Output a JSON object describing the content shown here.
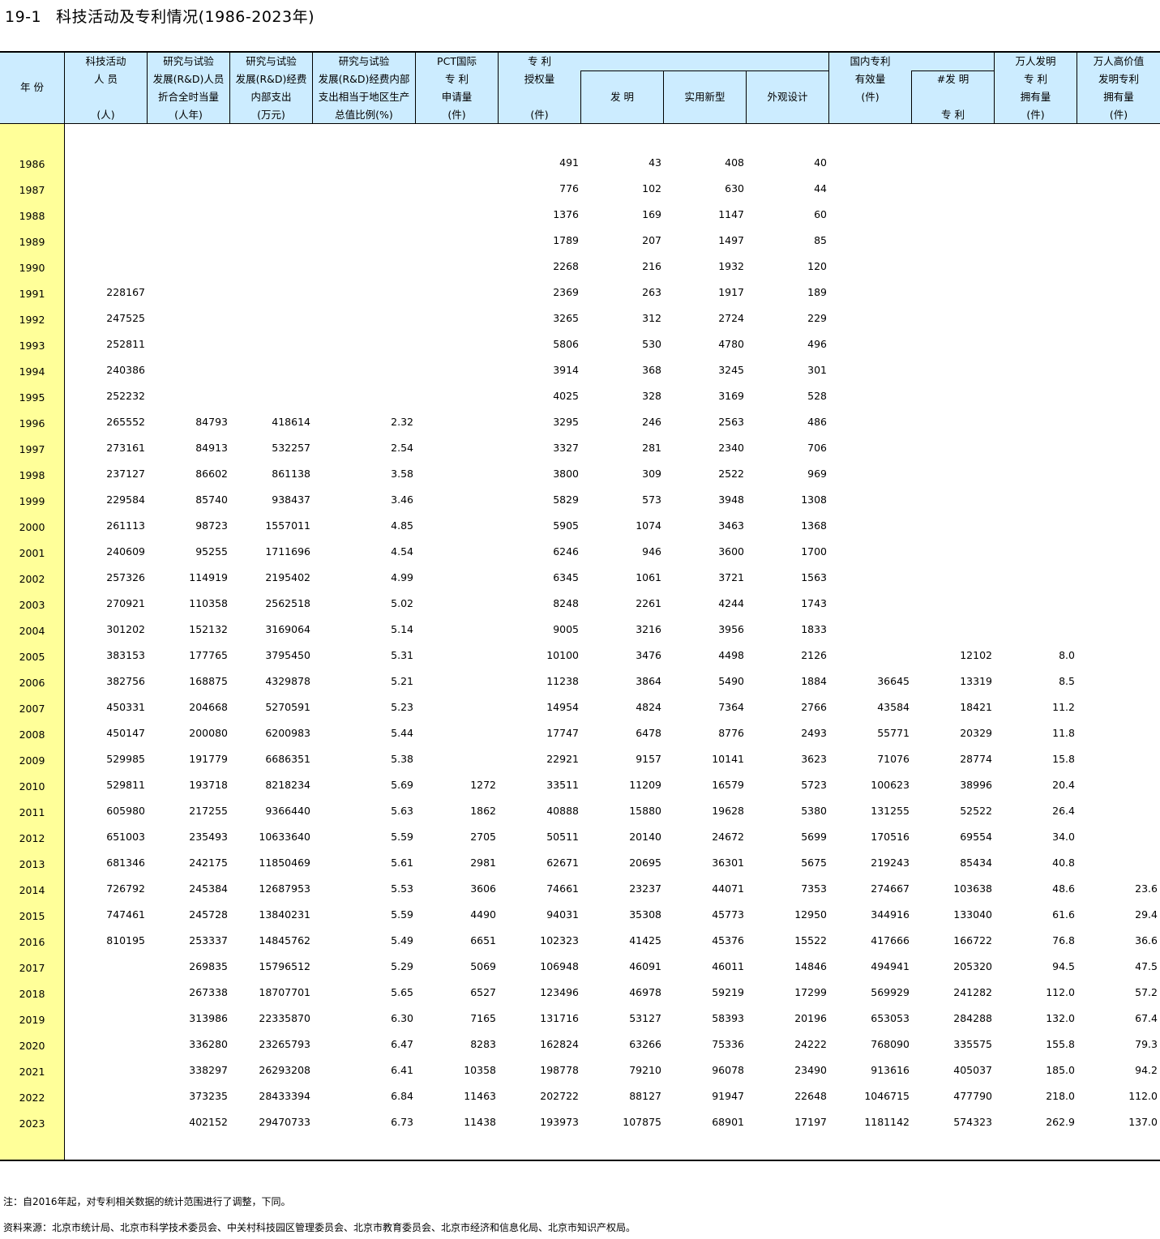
{
  "title": {
    "number": "19-1",
    "text": "科技活动及专利情况(1986-2023年)"
  },
  "headers": {
    "year": "年 份",
    "sci_staff": [
      "科技活动",
      "人 员",
      "",
      "(人)"
    ],
    "rd_staff": [
      "研究与试验",
      "发展(R&D)人员",
      "折合全时当量",
      "(人年)"
    ],
    "rd_exp": [
      "研究与试验",
      "发展(R&D)经费",
      "内部支出",
      "(万元)"
    ],
    "rd_ratio": [
      "研究与试验",
      "发展(R&D)经费内部",
      "支出相当于地区生产",
      "总值比例(%)"
    ],
    "pct": [
      "PCT国际",
      "专 利",
      "申请量",
      "(件)"
    ],
    "grants": [
      "专 利",
      "授权量",
      "",
      "(件)"
    ],
    "invention": "发 明",
    "utility": "实用新型",
    "design": "外观设计",
    "domestic": [
      "国内专利",
      "有效量",
      "(件)",
      ""
    ],
    "domestic_inv_top": "#发 明",
    "domestic_inv_bottom": "专 利",
    "per10k": [
      "万人发明",
      "专 利",
      "拥有量",
      "(件)"
    ],
    "per10k_hv": [
      "万人高价值",
      "发明专利",
      "拥有量",
      "(件)"
    ]
  },
  "rows": [
    [
      "1986",
      "",
      "",
      "",
      "",
      "",
      "491",
      "43",
      "408",
      "40",
      "",
      "",
      "",
      ""
    ],
    [
      "1987",
      "",
      "",
      "",
      "",
      "",
      "776",
      "102",
      "630",
      "44",
      "",
      "",
      "",
      ""
    ],
    [
      "1988",
      "",
      "",
      "",
      "",
      "",
      "1376",
      "169",
      "1147",
      "60",
      "",
      "",
      "",
      ""
    ],
    [
      "1989",
      "",
      "",
      "",
      "",
      "",
      "1789",
      "207",
      "1497",
      "85",
      "",
      "",
      "",
      ""
    ],
    [
      "1990",
      "",
      "",
      "",
      "",
      "",
      "2268",
      "216",
      "1932",
      "120",
      "",
      "",
      "",
      ""
    ],
    [
      "1991",
      "228167",
      "",
      "",
      "",
      "",
      "2369",
      "263",
      "1917",
      "189",
      "",
      "",
      "",
      ""
    ],
    [
      "1992",
      "247525",
      "",
      "",
      "",
      "",
      "3265",
      "312",
      "2724",
      "229",
      "",
      "",
      "",
      ""
    ],
    [
      "1993",
      "252811",
      "",
      "",
      "",
      "",
      "5806",
      "530",
      "4780",
      "496",
      "",
      "",
      "",
      ""
    ],
    [
      "1994",
      "240386",
      "",
      "",
      "",
      "",
      "3914",
      "368",
      "3245",
      "301",
      "",
      "",
      "",
      ""
    ],
    [
      "1995",
      "252232",
      "",
      "",
      "",
      "",
      "4025",
      "328",
      "3169",
      "528",
      "",
      "",
      "",
      ""
    ],
    [
      "1996",
      "265552",
      "84793",
      "418614",
      "2.32",
      "",
      "3295",
      "246",
      "2563",
      "486",
      "",
      "",
      "",
      ""
    ],
    [
      "1997",
      "273161",
      "84913",
      "532257",
      "2.54",
      "",
      "3327",
      "281",
      "2340",
      "706",
      "",
      "",
      "",
      ""
    ],
    [
      "1998",
      "237127",
      "86602",
      "861138",
      "3.58",
      "",
      "3800",
      "309",
      "2522",
      "969",
      "",
      "",
      "",
      ""
    ],
    [
      "1999",
      "229584",
      "85740",
      "938437",
      "3.46",
      "",
      "5829",
      "573",
      "3948",
      "1308",
      "",
      "",
      "",
      ""
    ],
    [
      "2000",
      "261113",
      "98723",
      "1557011",
      "4.85",
      "",
      "5905",
      "1074",
      "3463",
      "1368",
      "",
      "",
      "",
      ""
    ],
    [
      "2001",
      "240609",
      "95255",
      "1711696",
      "4.54",
      "",
      "6246",
      "946",
      "3600",
      "1700",
      "",
      "",
      "",
      ""
    ],
    [
      "2002",
      "257326",
      "114919",
      "2195402",
      "4.99",
      "",
      "6345",
      "1061",
      "3721",
      "1563",
      "",
      "",
      "",
      ""
    ],
    [
      "2003",
      "270921",
      "110358",
      "2562518",
      "5.02",
      "",
      "8248",
      "2261",
      "4244",
      "1743",
      "",
      "",
      "",
      ""
    ],
    [
      "2004",
      "301202",
      "152132",
      "3169064",
      "5.14",
      "",
      "9005",
      "3216",
      "3956",
      "1833",
      "",
      "",
      "",
      ""
    ],
    [
      "2005",
      "383153",
      "177765",
      "3795450",
      "5.31",
      "",
      "10100",
      "3476",
      "4498",
      "2126",
      "",
      "12102",
      "8.0",
      ""
    ],
    [
      "2006",
      "382756",
      "168875",
      "4329878",
      "5.21",
      "",
      "11238",
      "3864",
      "5490",
      "1884",
      "36645",
      "13319",
      "8.5",
      ""
    ],
    [
      "2007",
      "450331",
      "204668",
      "5270591",
      "5.23",
      "",
      "14954",
      "4824",
      "7364",
      "2766",
      "43584",
      "18421",
      "11.2",
      ""
    ],
    [
      "2008",
      "450147",
      "200080",
      "6200983",
      "5.44",
      "",
      "17747",
      "6478",
      "8776",
      "2493",
      "55771",
      "20329",
      "11.8",
      ""
    ],
    [
      "2009",
      "529985",
      "191779",
      "6686351",
      "5.38",
      "",
      "22921",
      "9157",
      "10141",
      "3623",
      "71076",
      "28774",
      "15.8",
      ""
    ],
    [
      "2010",
      "529811",
      "193718",
      "8218234",
      "5.69",
      "1272",
      "33511",
      "11209",
      "16579",
      "5723",
      "100623",
      "38996",
      "20.4",
      ""
    ],
    [
      "2011",
      "605980",
      "217255",
      "9366440",
      "5.63",
      "1862",
      "40888",
      "15880",
      "19628",
      "5380",
      "131255",
      "52522",
      "26.4",
      ""
    ],
    [
      "2012",
      "651003",
      "235493",
      "10633640",
      "5.59",
      "2705",
      "50511",
      "20140",
      "24672",
      "5699",
      "170516",
      "69554",
      "34.0",
      ""
    ],
    [
      "2013",
      "681346",
      "242175",
      "11850469",
      "5.61",
      "2981",
      "62671",
      "20695",
      "36301",
      "5675",
      "219243",
      "85434",
      "40.8",
      ""
    ],
    [
      "2014",
      "726792",
      "245384",
      "12687953",
      "5.53",
      "3606",
      "74661",
      "23237",
      "44071",
      "7353",
      "274667",
      "103638",
      "48.6",
      "23.6"
    ],
    [
      "2015",
      "747461",
      "245728",
      "13840231",
      "5.59",
      "4490",
      "94031",
      "35308",
      "45773",
      "12950",
      "344916",
      "133040",
      "61.6",
      "29.4"
    ],
    [
      "2016",
      "810195",
      "253337",
      "14845762",
      "5.49",
      "6651",
      "102323",
      "41425",
      "45376",
      "15522",
      "417666",
      "166722",
      "76.8",
      "36.6"
    ],
    [
      "2017",
      "",
      "269835",
      "15796512",
      "5.29",
      "5069",
      "106948",
      "46091",
      "46011",
      "14846",
      "494941",
      "205320",
      "94.5",
      "47.5"
    ],
    [
      "2018",
      "",
      "267338",
      "18707701",
      "5.65",
      "6527",
      "123496",
      "46978",
      "59219",
      "17299",
      "569929",
      "241282",
      "112.0",
      "57.2"
    ],
    [
      "2019",
      "",
      "313986",
      "22335870",
      "6.30",
      "7165",
      "131716",
      "53127",
      "58393",
      "20196",
      "653053",
      "284288",
      "132.0",
      "67.4"
    ],
    [
      "2020",
      "",
      "336280",
      "23265793",
      "6.47",
      "8283",
      "162824",
      "63266",
      "75336",
      "24222",
      "768090",
      "335575",
      "155.8",
      "79.3"
    ],
    [
      "2021",
      "",
      "338297",
      "26293208",
      "6.41",
      "10358",
      "198778",
      "79210",
      "96078",
      "23490",
      "913616",
      "405037",
      "185.0",
      "94.2"
    ],
    [
      "2022",
      "",
      "373235",
      "28433394",
      "6.84",
      "11463",
      "202722",
      "88127",
      "91947",
      "22648",
      "1046715",
      "477790",
      "218.0",
      "112.0"
    ],
    [
      "2023",
      "",
      "402152",
      "29470733",
      "6.73",
      "11438",
      "193973",
      "107875",
      "68901",
      "17197",
      "1181142",
      "574323",
      "262.9",
      "137.0"
    ]
  ],
  "notes": {
    "note": "注：自2016年起，对专利相关数据的统计范围进行了调整，下同。",
    "source": "资料来源：北京市统计局、北京市科学技术委员会、中关村科技园区管理委员会、北京市教育委员会、北京市经济和信息化局、北京市知识产权局。"
  }
}
